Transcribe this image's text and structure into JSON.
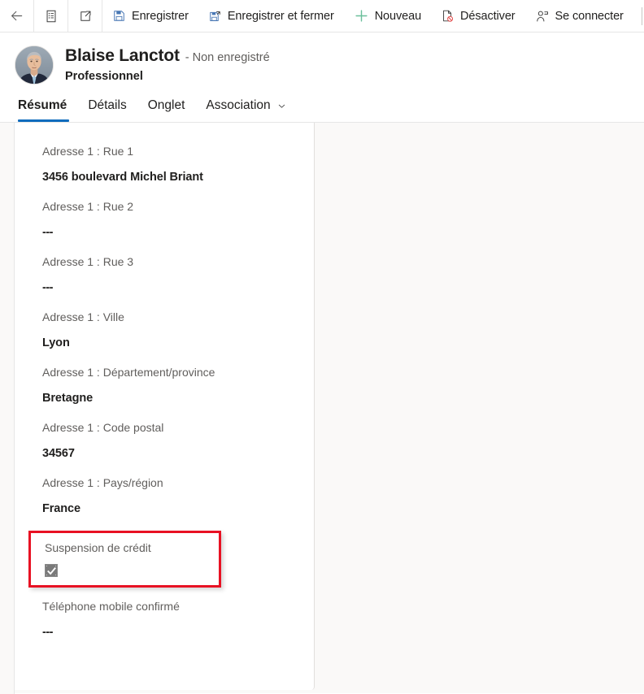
{
  "commandbar": {
    "icon_buttons": [
      {
        "name": "back-button",
        "icon": "back-arrow-icon"
      },
      {
        "name": "form-selector-button",
        "icon": "form-list-icon"
      },
      {
        "name": "open-popout-button",
        "icon": "popout-icon"
      }
    ],
    "commands": [
      {
        "label": "Enregistrer",
        "icon": "save-icon",
        "name": "save-button"
      },
      {
        "label": "Enregistrer et fermer",
        "icon": "save-and-close-icon",
        "name": "save-and-close-button"
      },
      {
        "label": "Nouveau",
        "icon": "plus-icon",
        "name": "new-button"
      },
      {
        "label": "Désactiver",
        "icon": "deactivate-icon",
        "name": "deactivate-button"
      },
      {
        "label": "Se connecter",
        "icon": "connect-icon",
        "name": "connect-button"
      }
    ],
    "overflow_icon": "chevron-down-icon"
  },
  "header": {
    "name": "Blaise Lanctot",
    "state": "- Non enregistré",
    "type": "Professionnel",
    "avatar_alt": "photo de contact"
  },
  "tabs": [
    {
      "label": "Résumé",
      "active": true,
      "has_chevron": false
    },
    {
      "label": "Détails",
      "active": false,
      "has_chevron": false
    },
    {
      "label": "Onglet",
      "active": false,
      "has_chevron": false
    },
    {
      "label": "Association",
      "active": false,
      "has_chevron": true
    }
  ],
  "form": {
    "fields": [
      {
        "label": "Adresse 1 : Rue 1",
        "value": "3456 boulevard Michel Briant",
        "type": "text",
        "empty": false
      },
      {
        "label": "Adresse 1 : Rue 2",
        "value": "---",
        "type": "text",
        "empty": true
      },
      {
        "label": "Adresse 1 : Rue 3",
        "value": "---",
        "type": "text",
        "empty": true
      },
      {
        "label": "Adresse 1 : Ville",
        "value": "Lyon",
        "type": "text",
        "empty": false
      },
      {
        "label": "Adresse 1 : Département/province",
        "value": "Bretagne",
        "type": "text",
        "empty": false
      },
      {
        "label": "Adresse 1 : Code postal",
        "value": "34567",
        "type": "text",
        "empty": false
      },
      {
        "label": "Adresse 1 : Pays/région",
        "value": "France",
        "type": "text",
        "empty": false
      },
      {
        "label": "Suspension de crédit",
        "value": "",
        "type": "checkbox",
        "checked": true,
        "highlighted": true
      },
      {
        "label": "Téléphone mobile confirmé",
        "value": "---",
        "type": "text",
        "empty": true
      }
    ]
  },
  "colors": {
    "accent": "#0f6cbd",
    "highlight_border": "#e81123",
    "canvas_bg": "#faf9f8",
    "card_bg": "#ffffff",
    "label_text": "#605e5c",
    "value_text": "#201f1e"
  }
}
